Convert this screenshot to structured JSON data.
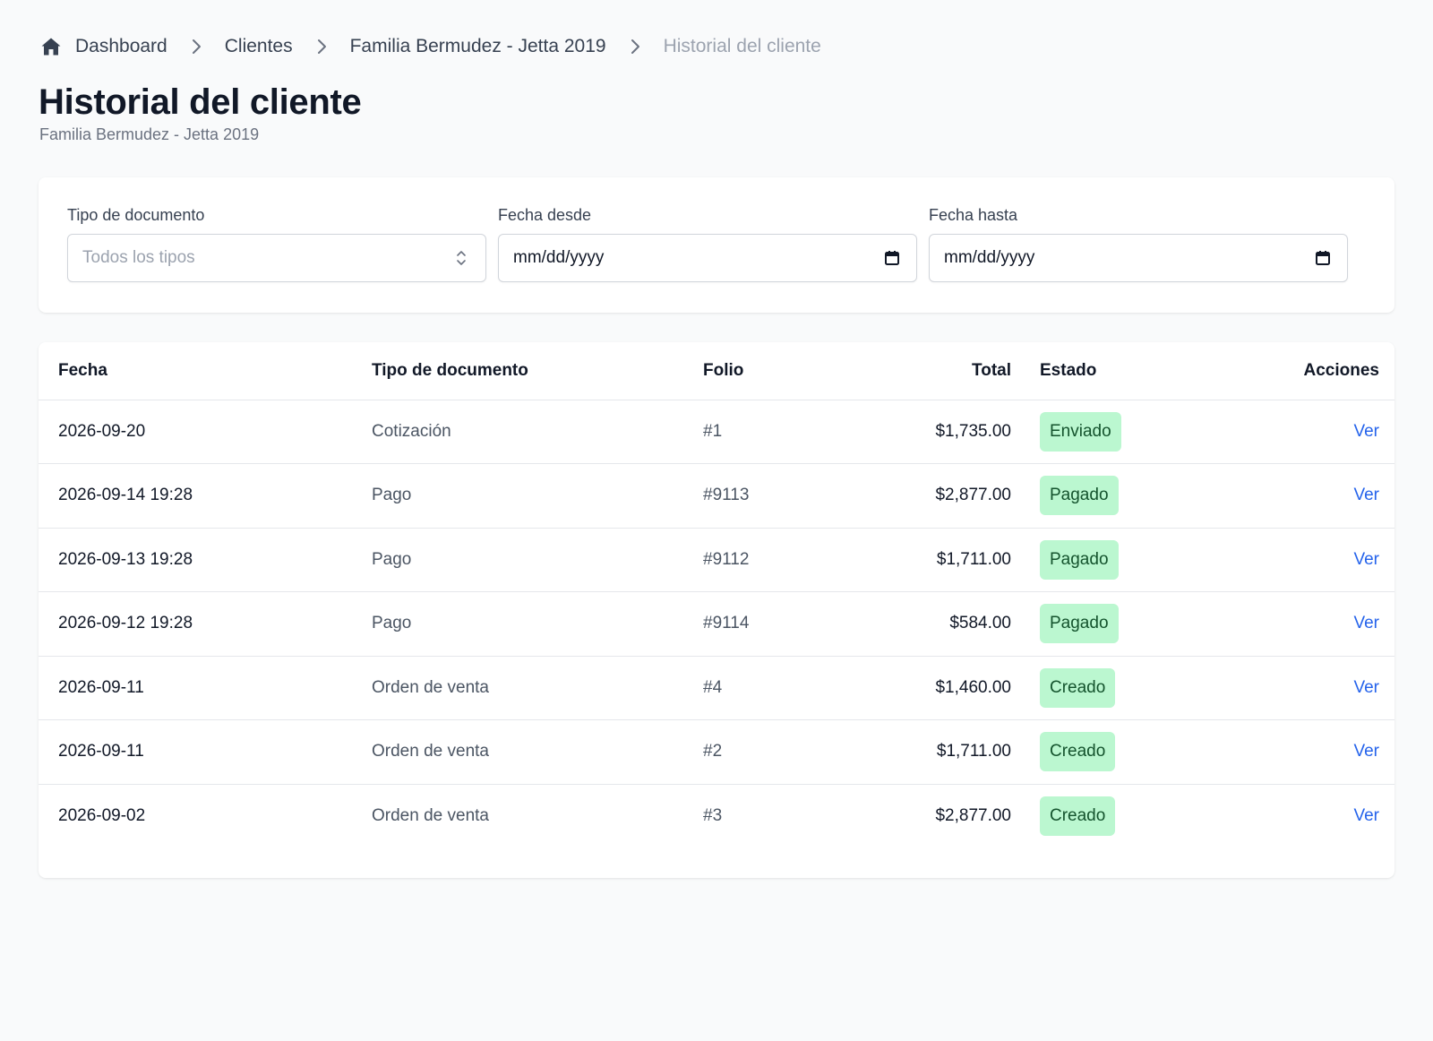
{
  "breadcrumb": {
    "items": [
      {
        "label": "Dashboard"
      },
      {
        "label": "Clientes"
      },
      {
        "label": "Familia Bermudez - Jetta 2019"
      }
    ],
    "current": "Historial del cliente"
  },
  "header": {
    "title": "Historial del cliente",
    "subtitle": "Familia Bermudez - Jetta 2019"
  },
  "filters": {
    "doc_type": {
      "label": "Tipo de documento",
      "placeholder": "Todos los tipos"
    },
    "date_from": {
      "label": "Fecha desde",
      "value": "mm/dd/yyyy"
    },
    "date_to": {
      "label": "Fecha hasta",
      "value": "mm/dd/yyyy"
    }
  },
  "table": {
    "columns": {
      "fecha": "Fecha",
      "tipo": "Tipo de documento",
      "folio": "Folio",
      "total": "Total",
      "estado": "Estado",
      "acciones": "Acciones"
    },
    "rows": [
      {
        "fecha": "2026-09-20",
        "tipo": "Cotización",
        "folio": "#1",
        "total": "$1,735.00",
        "estado": "Enviado",
        "accion": "Ver"
      },
      {
        "fecha": "2026-09-14 19:28",
        "tipo": "Pago",
        "folio": "#9113",
        "total": "$2,877.00",
        "estado": "Pagado",
        "accion": "Ver"
      },
      {
        "fecha": "2026-09-13 19:28",
        "tipo": "Pago",
        "folio": "#9112",
        "total": "$1,711.00",
        "estado": "Pagado",
        "accion": "Ver"
      },
      {
        "fecha": "2026-09-12 19:28",
        "tipo": "Pago",
        "folio": "#9114",
        "total": "$584.00",
        "estado": "Pagado",
        "accion": "Ver"
      },
      {
        "fecha": "2026-09-11",
        "tipo": "Orden de venta",
        "folio": "#4",
        "total": "$1,460.00",
        "estado": "Creado",
        "accion": "Ver"
      },
      {
        "fecha": "2026-09-11",
        "tipo": "Orden de venta",
        "folio": "#2",
        "total": "$1,711.00",
        "estado": "Creado",
        "accion": "Ver"
      },
      {
        "fecha": "2026-09-02",
        "tipo": "Orden de venta",
        "folio": "#3",
        "total": "$2,877.00",
        "estado": "Creado",
        "accion": "Ver"
      }
    ]
  },
  "icons": {
    "home": "home-icon",
    "separator": "chevron-right-icon",
    "select": "chevron-up-down-icon",
    "calendar": "calendar-icon"
  },
  "colors": {
    "link": "#2563eb",
    "badge_bg": "#bbf7d0",
    "badge_text": "#14532d"
  }
}
